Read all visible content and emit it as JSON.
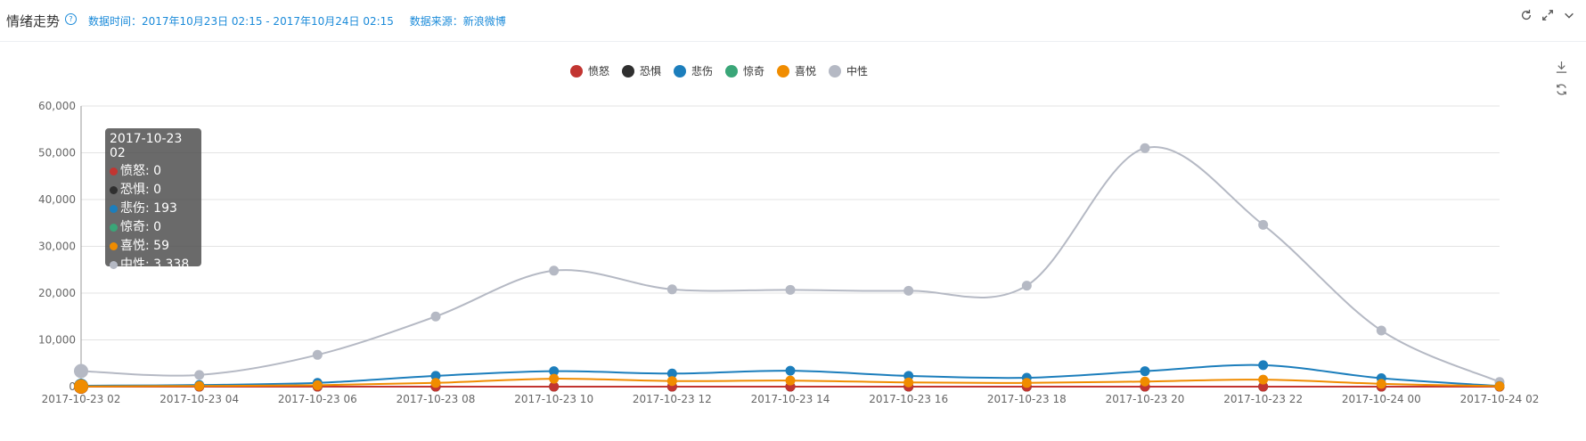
{
  "header": {
    "title": "情绪走势",
    "help_glyph": "?",
    "data_time": "数据时间：2017年10月23日 02:15 - 2017年10月24日 02:15",
    "data_source": "数据来源：新浪微博"
  },
  "icons": [
    "refresh-icon",
    "expand-icon",
    "chevron-down-icon",
    "download-icon",
    "restore-icon"
  ],
  "tooltip": {
    "title": "2017-10-23 02",
    "rows": [
      {
        "label": "愤怒: 0",
        "color": "#c23531"
      },
      {
        "label": "恐惧: 0",
        "color": "#2f2f2f"
      },
      {
        "label": "悲伤: 193",
        "color": "#1c7ebc"
      },
      {
        "label": "惊奇: 0",
        "color": "#3aa678"
      },
      {
        "label": "喜悦: 59",
        "color": "#f08c00"
      },
      {
        "label": "中性: 3,338",
        "color": "#b5b9c4"
      }
    ]
  },
  "chart_data": {
    "type": "line",
    "smooth": true,
    "x": [
      "2017-10-23 02",
      "2017-10-23 04",
      "2017-10-23 06",
      "2017-10-23 08",
      "2017-10-23 10",
      "2017-10-23 12",
      "2017-10-23 14",
      "2017-10-23 16",
      "2017-10-23 18",
      "2017-10-23 20",
      "2017-10-23 22",
      "2017-10-24 00",
      "2017-10-24 02"
    ],
    "ylim": [
      0,
      60000
    ],
    "yticks": [
      0,
      10000,
      20000,
      30000,
      40000,
      50000,
      60000
    ],
    "ytick_labels": [
      "0",
      "10,000",
      "20,000",
      "30,000",
      "40,000",
      "50,000",
      "60,000"
    ],
    "grid": true,
    "legend_position": "top-center",
    "series": [
      {
        "name": "愤怒",
        "color": "#c23531",
        "values": [
          0,
          0,
          0,
          0,
          0,
          0,
          0,
          0,
          0,
          0,
          0,
          0,
          0
        ]
      },
      {
        "name": "恐惧",
        "color": "#2f2f2f",
        "values": [
          0,
          0,
          0,
          0,
          0,
          0,
          0,
          0,
          0,
          0,
          0,
          0,
          0
        ]
      },
      {
        "name": "悲伤",
        "color": "#1c7ebc",
        "values": [
          193,
          350,
          800,
          2300,
          3300,
          2800,
          3400,
          2300,
          1900,
          3300,
          4600,
          1800,
          150
        ]
      },
      {
        "name": "惊奇",
        "color": "#3aa678",
        "values": [
          0,
          0,
          0,
          0,
          0,
          0,
          0,
          0,
          0,
          0,
          0,
          0,
          0
        ]
      },
      {
        "name": "喜悦",
        "color": "#f08c00",
        "values": [
          59,
          150,
          300,
          800,
          1700,
          1200,
          1300,
          900,
          800,
          1100,
          1500,
          600,
          100
        ]
      },
      {
        "name": "中性",
        "color": "#b5b9c4",
        "values": [
          3338,
          2500,
          6800,
          15000,
          24800,
          20800,
          20700,
          20500,
          21600,
          51000,
          34600,
          12000,
          1000
        ]
      }
    ]
  }
}
